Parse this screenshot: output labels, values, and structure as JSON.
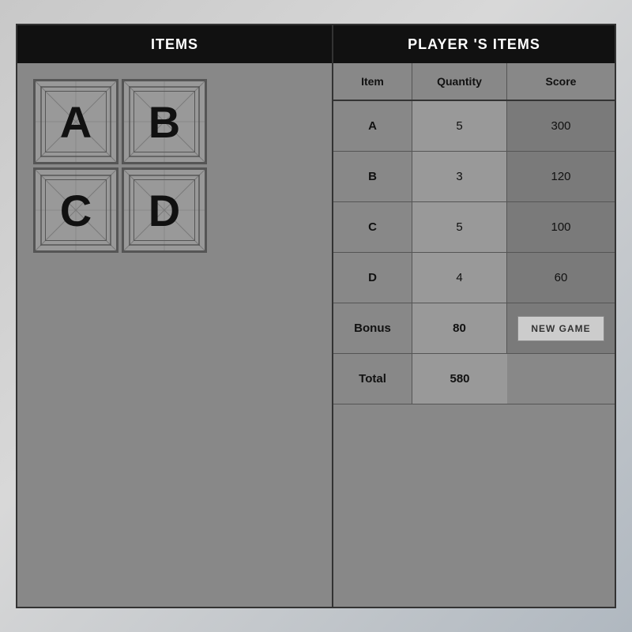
{
  "header": {
    "items_label": "ITEMS",
    "players_label": "PLAYER 'S ITEMS"
  },
  "items_grid": [
    {
      "id": "A",
      "label": "A"
    },
    {
      "id": "B",
      "label": "B"
    },
    {
      "id": "C",
      "label": "C"
    },
    {
      "id": "D",
      "label": "D"
    }
  ],
  "table": {
    "col_item": "Item",
    "col_quantity": "Quantity",
    "col_score": "Score",
    "rows": [
      {
        "item": "A",
        "quantity": "5",
        "score": "300"
      },
      {
        "item": "B",
        "quantity": "3",
        "score": "120"
      },
      {
        "item": "C",
        "quantity": "5",
        "score": "100"
      },
      {
        "item": "D",
        "quantity": "4",
        "score": "60"
      }
    ],
    "bonus_label": "Bonus",
    "bonus_value": "80",
    "new_game_label": "NEW GAME",
    "total_label": "Total",
    "total_value": "580"
  }
}
